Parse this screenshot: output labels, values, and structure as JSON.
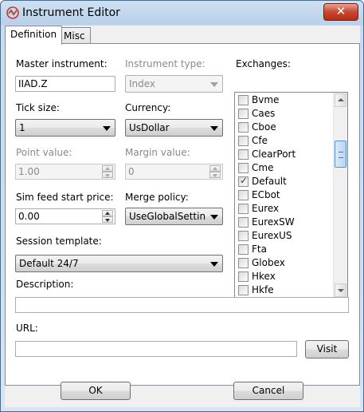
{
  "window": {
    "title": "Instrument Editor",
    "close_label": "✕"
  },
  "tabs": [
    {
      "label": "Definition"
    },
    {
      "label": "Misc"
    }
  ],
  "form": {
    "master_instrument_label": "Master instrument:",
    "master_instrument_value": "IIAD.Z",
    "instrument_type_label": "Instrument type:",
    "instrument_type_value": "Index",
    "tick_size_label": "Tick size:",
    "tick_size_value": "1",
    "currency_label": "Currency:",
    "currency_value": "UsDollar",
    "point_value_label": "Point value:",
    "point_value_value": "1.00",
    "margin_value_label": "Margin value:",
    "margin_value_value": "0",
    "sim_feed_label": "Sim feed start price:",
    "sim_feed_value": "0.00",
    "merge_policy_label": "Merge policy:",
    "merge_policy_value": "UseGlobalSettin",
    "session_template_label": "Session template:",
    "session_template_value": "Default 24/7",
    "description_label": "Description:",
    "description_value": "",
    "url_label": "URL:",
    "url_value": "",
    "visit_label": "Visit"
  },
  "exchanges": {
    "label": "Exchanges:",
    "items": [
      {
        "name": "Bvme",
        "checked": false
      },
      {
        "name": "Caes",
        "checked": false
      },
      {
        "name": "Cboe",
        "checked": false
      },
      {
        "name": "Cfe",
        "checked": false
      },
      {
        "name": "ClearPort",
        "checked": false
      },
      {
        "name": "Cme",
        "checked": false
      },
      {
        "name": "Default",
        "checked": true
      },
      {
        "name": "ECbot",
        "checked": false
      },
      {
        "name": "Eurex",
        "checked": false
      },
      {
        "name": "EurexSW",
        "checked": false
      },
      {
        "name": "EurexUS",
        "checked": false
      },
      {
        "name": "Fta",
        "checked": false
      },
      {
        "name": "Globex",
        "checked": false
      },
      {
        "name": "Hkex",
        "checked": false
      },
      {
        "name": "Hkfe",
        "checked": false
      }
    ]
  },
  "footer": {
    "ok_label": "OK",
    "cancel_label": "Cancel"
  },
  "colors": {
    "title_bar": "#b9d1ea",
    "close_button": "#c9462f",
    "scroll_thumb": "#b7d5f3"
  }
}
